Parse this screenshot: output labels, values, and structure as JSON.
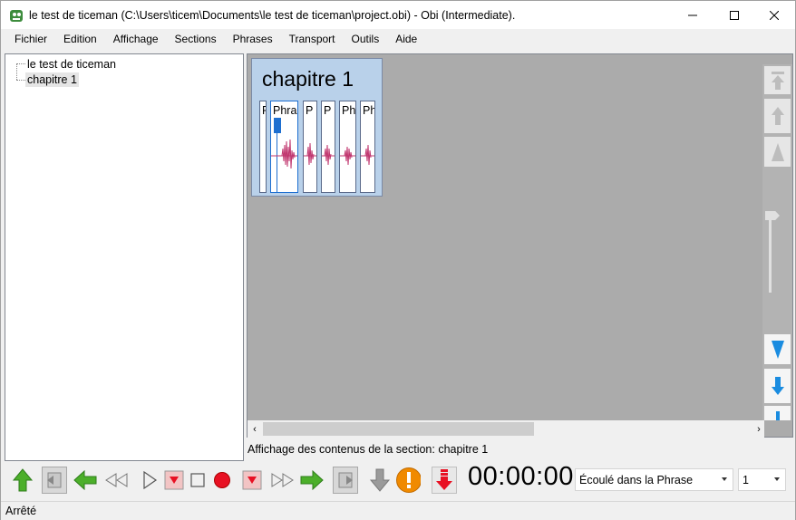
{
  "window": {
    "title": "le test de ticeman (C:\\Users\\ticem\\Documents\\le test de ticeman\\project.obi) - Obi (Intermediate).",
    "minimize_icon": "minimize-icon",
    "maximize_icon": "maximize-icon",
    "close_icon": "close-icon"
  },
  "menu": {
    "items": [
      "Fichier",
      "Edition",
      "Affichage",
      "Sections",
      "Phrases",
      "Transport",
      "Outils",
      "Aide"
    ]
  },
  "tree": {
    "root": "le test de ticeman",
    "child": "chapitre 1"
  },
  "content": {
    "section_title": "chapitre 1",
    "blocks": [
      "P",
      "Phra",
      "P",
      "P",
      "Ph",
      "Ph"
    ],
    "status": "Affichage des contenus de la section:  chapitre 1"
  },
  "toolbar": {
    "icons": [
      "up-arrow-icon",
      "prev-page-icon",
      "prev-phrase-icon",
      "rewind-icon",
      "play-icon",
      "mark-icon",
      "stop-icon",
      "record-icon",
      "mark-icon",
      "fast-forward-icon",
      "next-phrase-icon",
      "next-page-icon",
      "down-arrow-icon",
      "warning-icon",
      "down-double-arrow-icon"
    ],
    "time": "00:00:00",
    "time_mode": "Écoulé dans la Phrase",
    "level": "1"
  },
  "statusbar": {
    "text": "Arrêté"
  },
  "colors": {
    "section_bg": "#b9d1ea",
    "waveform": "#c0356e",
    "cursor": "#1e6fd0",
    "green_arrow": "#4caf2a",
    "record_red": "#e81123",
    "warning_orange": "#f08a00"
  }
}
